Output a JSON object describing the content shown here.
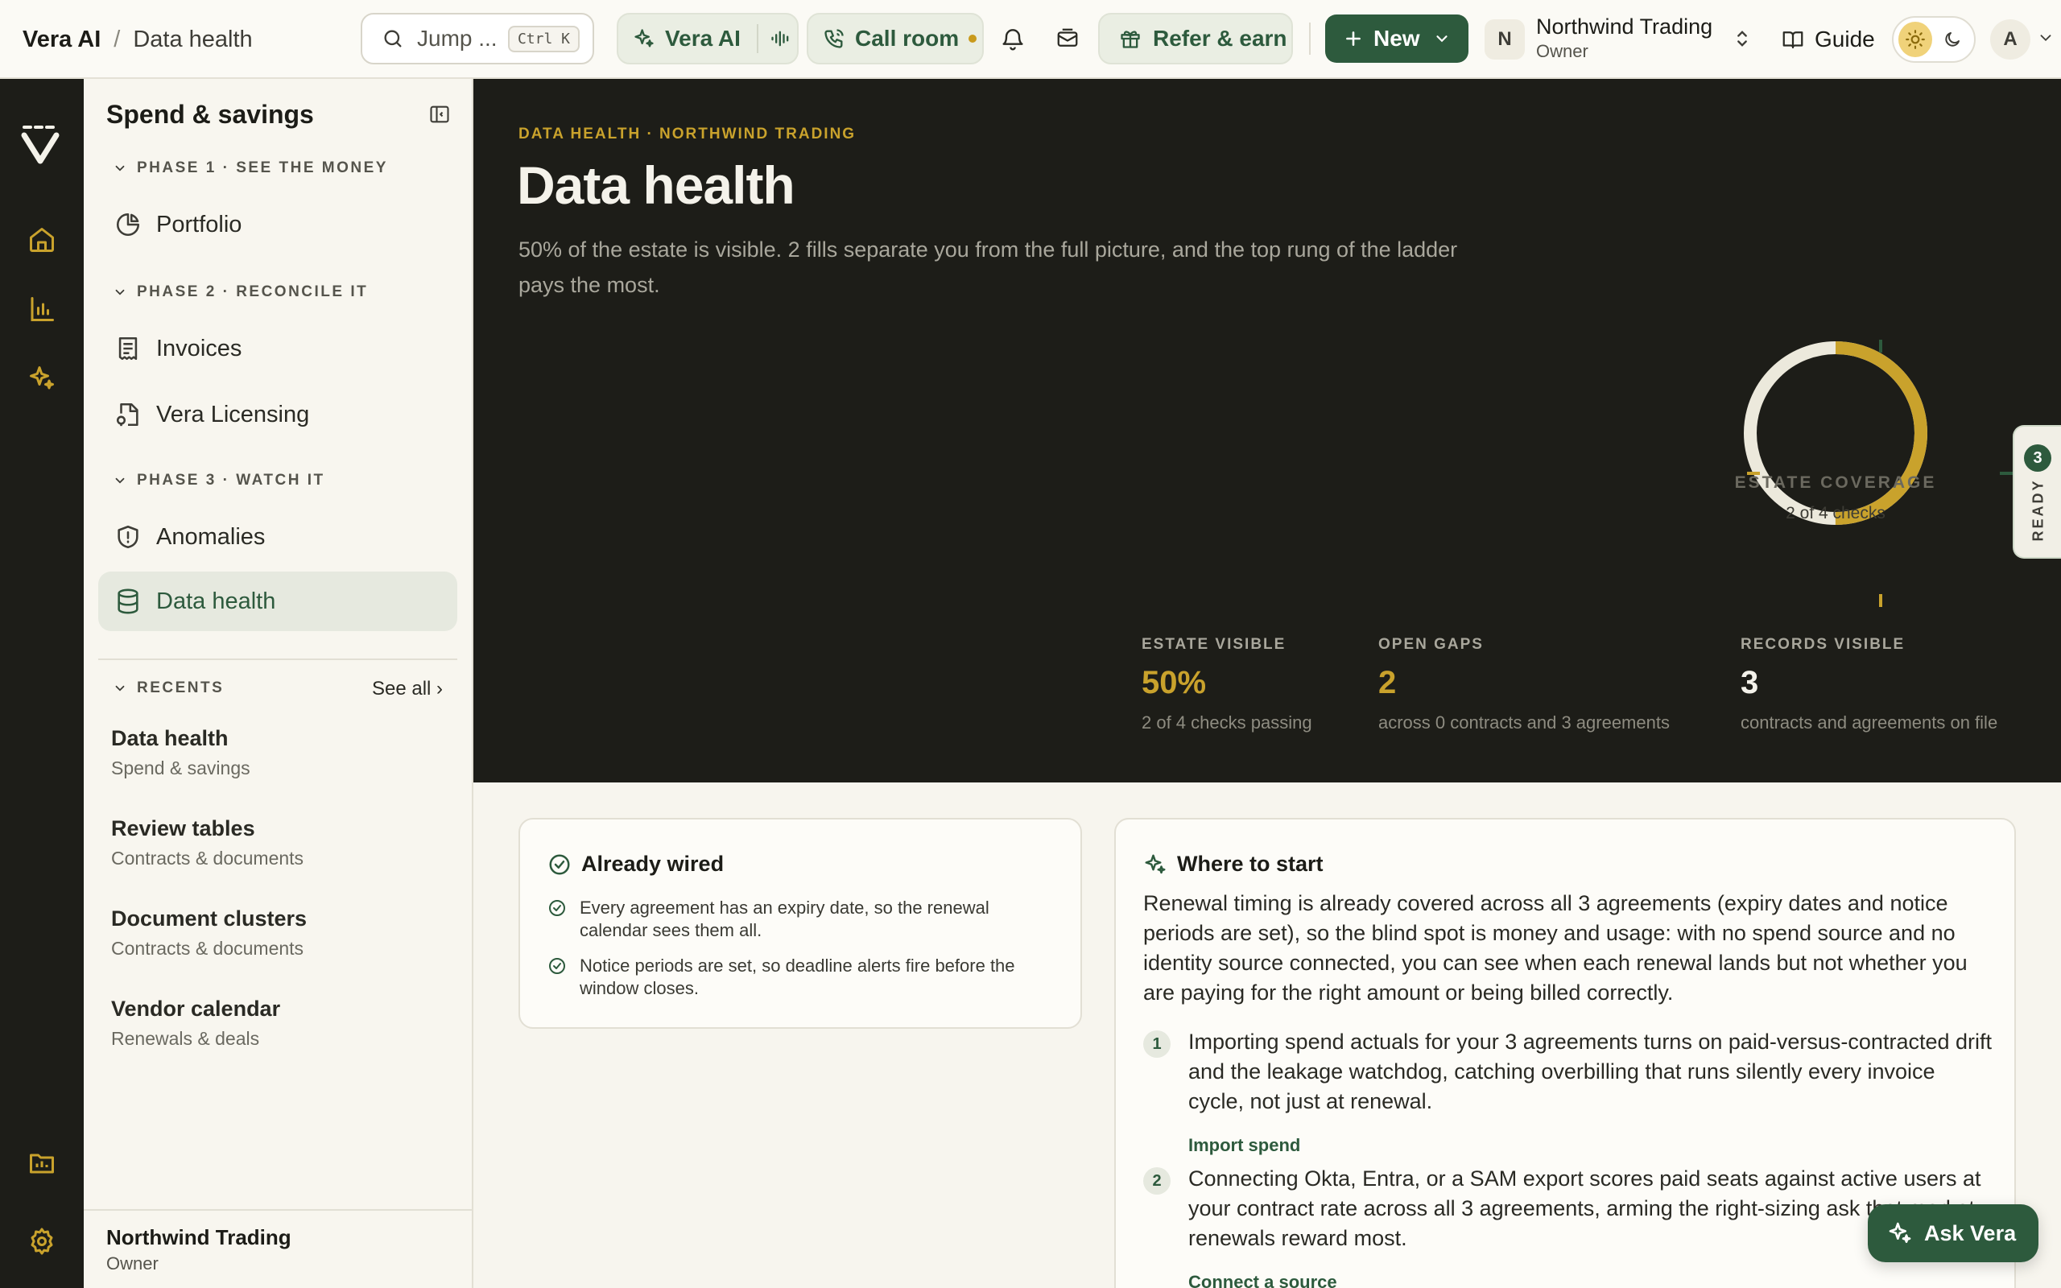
{
  "topbar": {
    "breadcrumb_root": "Vera AI",
    "breadcrumb_sep": "/",
    "breadcrumb_current": "Data health",
    "search_placeholder": "Jump ...",
    "search_shortcut": "Ctrl K",
    "vera_label": "Vera AI",
    "call_label": "Call room",
    "refer_label": "Refer & earn",
    "new_label": "New",
    "org_initial": "N",
    "org_name": "Northwind Trading",
    "org_role": "Owner",
    "guide_label": "Guide",
    "avatar_initial": "A"
  },
  "rail": {
    "icons": [
      "vera-logo-icon",
      "home-icon",
      "bar-chart-icon",
      "sparkle-icon",
      "folder-chart-icon",
      "gear-icon"
    ]
  },
  "sidebar": {
    "title": "Spend & savings",
    "phases": [
      {
        "label": "PHASE 1 · SEE THE MONEY"
      },
      {
        "label": "PHASE 2 · RECONCILE IT"
      },
      {
        "label": "PHASE 3 · WATCH IT"
      }
    ],
    "items": [
      {
        "label": "Portfolio"
      },
      {
        "label": "Invoices"
      },
      {
        "label": "Vera Licensing"
      },
      {
        "label": "Anomalies"
      },
      {
        "label": "Data health",
        "active": true
      }
    ],
    "recents_label": "RECENTS",
    "see_all": "See all ›",
    "recents": [
      {
        "title": "Data health",
        "sub": "Spend & savings"
      },
      {
        "title": "Review tables",
        "sub": "Contracts & documents"
      },
      {
        "title": "Document clusters",
        "sub": "Contracts & documents"
      },
      {
        "title": "Vendor calendar",
        "sub": "Renewals & deals"
      }
    ],
    "footer_name": "Northwind Trading",
    "footer_role": "Owner"
  },
  "hero": {
    "eyebrow": "DATA HEALTH · NORTHWIND TRADING",
    "title": "Data health",
    "subtitle": "50% of the estate is visible. 2 fills separate you from the full picture, and the top rung of the ladder pays the most.",
    "gauge": {
      "label": "ESTATE COVERAGE",
      "sub": "2 of 4 checks",
      "fraction": 0.5,
      "track_color": "#ece9dc",
      "fill_color": "#c9a22c"
    },
    "ready_count": "3",
    "ready_label": "READY",
    "stats": [
      {
        "key": "ESTATE VISIBLE",
        "value": "50%",
        "desc": "2 of 4 checks passing",
        "color": "#c9a22c"
      },
      {
        "key": "OPEN GAPS",
        "value": "2",
        "desc": "across 0 contracts and 3 agreements",
        "color": "#c9a22c"
      },
      {
        "key": "RECORDS VISIBLE",
        "value": "3",
        "desc": "contracts and agreements on file",
        "color": "#f4f2ea"
      }
    ]
  },
  "wired": {
    "title": "Already wired",
    "items": [
      {
        "text": "Every agreement has an expiry date, so the renewal calendar sees them all."
      },
      {
        "text": "Notice periods are set, so deadline alerts fire before the window closes."
      }
    ]
  },
  "start": {
    "title": "Where to start",
    "intro": "Renewal timing is already covered across all 3 agreements (expiry dates and notice periods are set), so the blind spot is money and usage: with no spend source and no identity source connected, you can see when each renewal lands but not whether you are paying for the right amount or being billed correctly.",
    "steps": [
      {
        "num": "1",
        "text": "Importing spend actuals for your 3 agreements turns on paid-versus-contracted drift and the leakage watchdog, catching overbilling that runs silently every invoice cycle, not just at renewal.",
        "link": "Import spend"
      },
      {
        "num": "2",
        "text": "Connecting Okta, Entra, or a SAM export scores paid seats against active users at your contract rate across all 3 agreements, arming the right-sizing ask that market renewals reward most.",
        "link": "Connect a source"
      }
    ]
  },
  "ask_label": "Ask Vera",
  "colors": {
    "brand": "#2d5a3d",
    "accent": "#c9a22c",
    "dark": "#1d1d18"
  }
}
